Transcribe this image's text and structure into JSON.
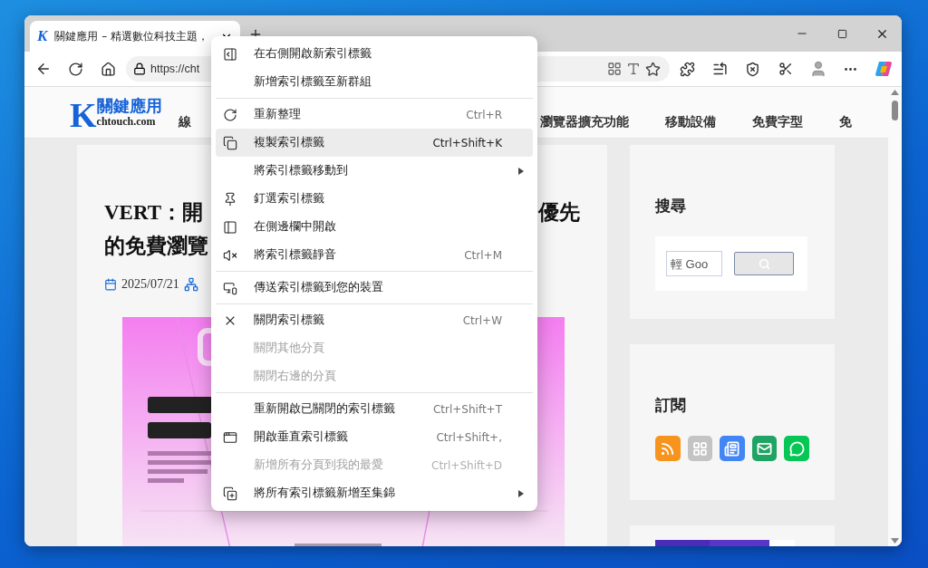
{
  "tab": {
    "favicon": "K",
    "title": "關鍵應用 – 精選數位科技主題，",
    "selected": true
  },
  "address_bar": {
    "url": "https://cht"
  },
  "site": {
    "logo": {
      "letter": "K",
      "name": "關鍵應用",
      "domain": "chtouch.com"
    },
    "nav": [
      "線",
      "瀏覽器擴充功能",
      "移動設備",
      "免費字型",
      "免"
    ]
  },
  "article": {
    "title_lines": [
      [
        "VERT：開",
        "優先"
      ],
      [
        "的免費瀏覽"
      ]
    ],
    "date": "2025/07/21",
    "picture": {
      "kind": "picture"
    }
  },
  "sidebar": [
    {
      "kind": "search",
      "heading": "搜尋",
      "placeholder": "輕 Goo"
    },
    {
      "kind": "subscribe",
      "heading": "訂閱",
      "feeds": [
        {
          "color": "#f7941d"
        },
        {
          "color": "#c4c4c4"
        },
        {
          "color": "#4285f4"
        },
        {
          "color": "#1fa463"
        },
        {
          "color": "#06c755"
        }
      ]
    },
    {
      "kind": "ad"
    }
  ],
  "context_menu": [
    [
      {
        "label": "在右側開啟新索引標籤",
        "selected": false,
        "disabled": false
      },
      {
        "label": "新增索引標籤至新群組",
        "selected": false,
        "disabled": false
      }
    ],
    [
      {
        "label": "重新整理",
        "shortcut": "Ctrl+R",
        "selected": false,
        "disabled": false
      },
      {
        "label": "複製索引標籤",
        "shortcut": "Ctrl+Shift+K",
        "selected": true,
        "disabled": false
      },
      {
        "label": "將索引標籤移動到",
        "submenu": true,
        "selected": false,
        "disabled": false
      },
      {
        "label": "釘選索引標籤",
        "selected": false,
        "disabled": false
      },
      {
        "label": "在側邊欄中開啟",
        "selected": false,
        "disabled": false
      },
      {
        "label": "將索引標籤靜音",
        "shortcut": "Ctrl+M",
        "selected": false,
        "disabled": false
      }
    ],
    [
      {
        "label": "傳送索引標籤到您的裝置",
        "selected": false,
        "disabled": false
      }
    ],
    [
      {
        "label": "關閉索引標籤",
        "shortcut": "Ctrl+W",
        "selected": false,
        "disabled": false
      },
      {
        "label": "關閉其他分頁",
        "selected": false,
        "disabled": true
      },
      {
        "label": "關閉右邊的分頁",
        "selected": false,
        "disabled": true
      }
    ],
    [
      {
        "label": "重新開啟已關閉的索引標籤",
        "shortcut": "Ctrl+Shift+T",
        "selected": false,
        "disabled": false
      },
      {
        "label": "開啟垂直索引標籤",
        "shortcut": "Ctrl+Shift+,",
        "selected": false,
        "disabled": false
      },
      {
        "label": "新增所有分頁到我的最愛",
        "shortcut": "Ctrl+Shift+D",
        "selected": false,
        "disabled": true
      },
      {
        "label": "將所有索引標籤新增至集錦",
        "submenu": true,
        "selected": false,
        "disabled": false
      }
    ]
  ]
}
